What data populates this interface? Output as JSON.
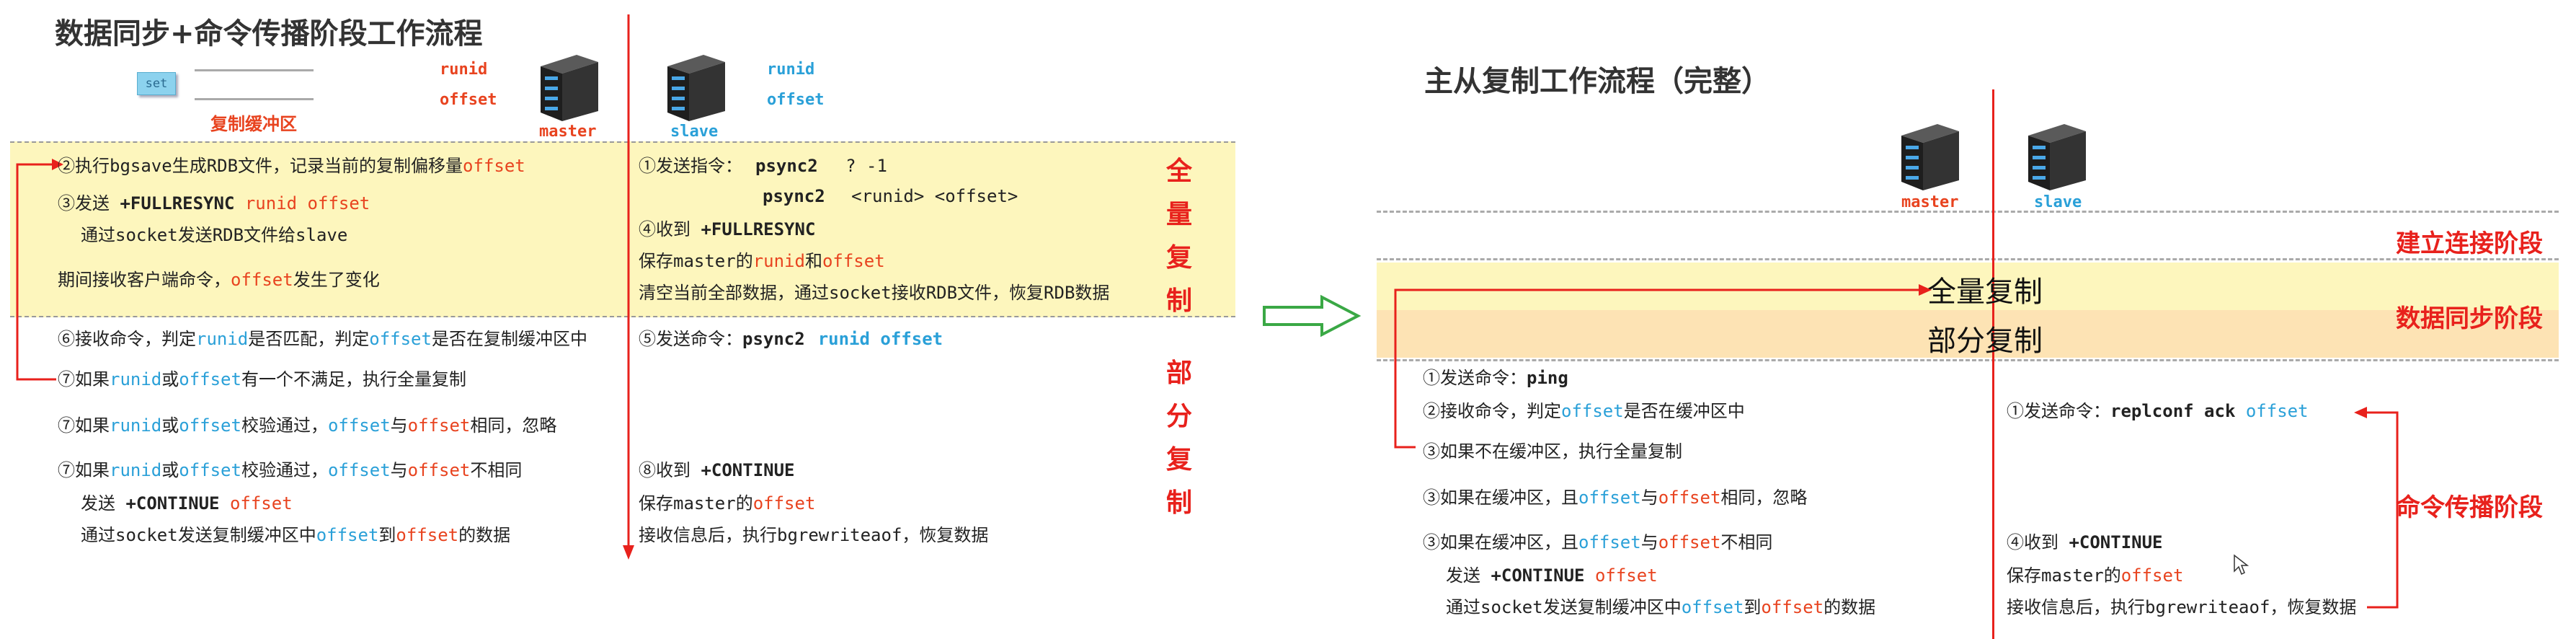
{
  "colors": {
    "red": "#e8431f",
    "blue": "#2aa0d8",
    "band_yellow": "#fdf6bd",
    "band_orange": "#fde3b4",
    "arrow_green": "#3aa845"
  },
  "left": {
    "title": "数据同步+命令传播阶段工作流程",
    "set_label": "set",
    "buffer_label": "复制缓冲区",
    "master_runid": "runid",
    "master_offset": "offset",
    "master_label": "master",
    "slave_label": "slave",
    "slave_runid": "runid",
    "slave_offset": "offset",
    "phase_full": [
      "全",
      "量",
      "复",
      "制"
    ],
    "phase_partial": [
      "部",
      "分",
      "复",
      "制"
    ],
    "m1": [
      "②执行bgsave生成RDB文件，记录当前的复制偏移量",
      "offset"
    ],
    "m2": [
      "③发送 ",
      "+FULLRESYNC",
      " runid offset"
    ],
    "m3": "通过socket发送RDB文件给slave",
    "m4": [
      "期间接收客户端命令，",
      "offset",
      "发生了变化"
    ],
    "m5": [
      "⑥接收命令，判定",
      "runid",
      "是否匹配，判定",
      "offset",
      "是否在复制缓冲区中"
    ],
    "m6": [
      "⑦如果",
      "runid",
      "或",
      "offset",
      "有一个不满足，执行全量复制"
    ],
    "m7": [
      "⑦如果",
      "runid",
      "或",
      "offset",
      "校验通过，",
      "offset",
      "与",
      "offset",
      "相同，忽略"
    ],
    "m8": [
      "⑦如果",
      "runid",
      "或",
      "offset",
      "校验通过，",
      "offset",
      "与",
      "offset",
      "不相同"
    ],
    "m9": [
      "发送 ",
      "+CONTINUE",
      " offset"
    ],
    "m10": [
      "通过socket发送复制缓冲区中",
      "offset",
      "到",
      "offset",
      "的数据"
    ],
    "s1": [
      "①发送指令：",
      "psync2",
      "  ? -1"
    ],
    "s2": [
      "psync2",
      "  <runid> <offset>"
    ],
    "s3": [
      "④收到 ",
      "+FULLRESYNC"
    ],
    "s4": [
      "保存master的",
      "runid",
      "和",
      "offset"
    ],
    "s5": "清空当前全部数据，通过socket接收RDB文件，恢复RDB数据",
    "s6": [
      "⑤发送命令：",
      "psync2",
      "runid offset"
    ],
    "s7": [
      "⑧收到 ",
      "+CONTINUE"
    ],
    "s8": [
      "保存master的",
      "offset"
    ],
    "s9": "接收信息后，执行bgrewriteaof，恢复数据"
  },
  "right": {
    "title": "主从复制工作流程（完整）",
    "master_label": "master",
    "slave_label": "slave",
    "stage_connect": "建立连接阶段",
    "stage_sync": "数据同步阶段",
    "stage_propagate": "命令传播阶段",
    "full_copy": "全量复制",
    "partial_copy": "部分复制",
    "m1": [
      "①发送命令：",
      "ping"
    ],
    "m2": [
      "②接收命令，判定",
      "offset",
      "是否在缓冲区中"
    ],
    "m3": "③如果不在缓冲区，执行全量复制",
    "m4": [
      "③如果在缓冲区，且",
      "offset",
      "与",
      "offset",
      "相同，忽略"
    ],
    "m5": [
      "③如果在缓冲区，且",
      "offset",
      "与",
      "offset",
      "不相同"
    ],
    "m6": [
      "发送 ",
      "+CONTINUE",
      " offset"
    ],
    "m7": [
      "通过socket发送复制缓冲区中",
      "offset",
      "到",
      "offset",
      "的数据"
    ],
    "s1": [
      "①发送命令：",
      "replconf ack",
      " offset"
    ],
    "s2": [
      "④收到 ",
      "+CONTINUE"
    ],
    "s3": [
      "保存master的",
      "offset"
    ],
    "s4": "接收信息后，执行bgrewriteaof，恢复数据"
  }
}
